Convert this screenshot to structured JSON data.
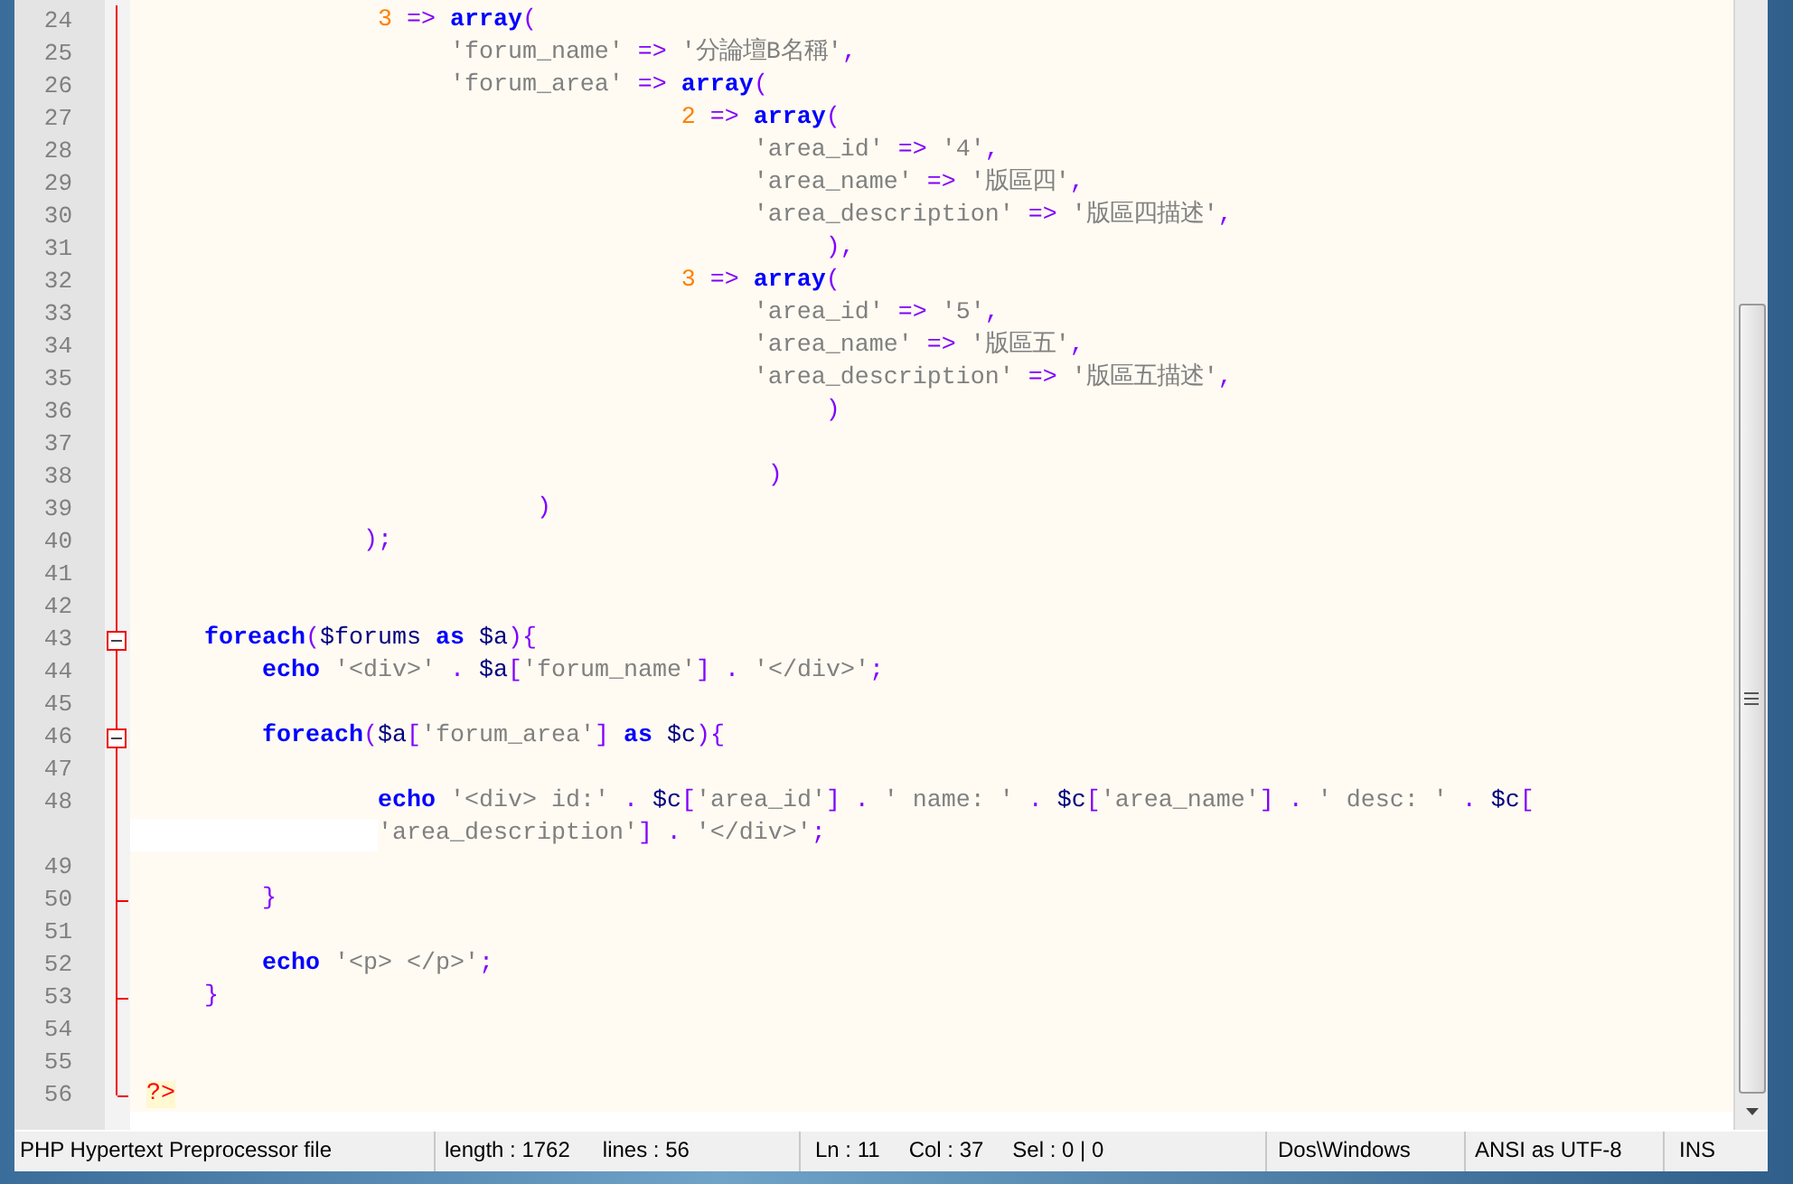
{
  "editor": {
    "lines": [
      {
        "number": "24",
        "fold_start": false,
        "fold_end": false,
        "tokens": [
          {
            "kind": "number",
            "text": "3"
          },
          {
            "kind": "operator",
            "text": " =>"
          },
          {
            "kind": "keyword",
            "text": " array"
          },
          {
            "kind": "operator",
            "text": "("
          }
        ]
      },
      {
        "number": "25",
        "fold_start": false,
        "fold_end": false,
        "tokens": [
          {
            "kind": "string",
            "text": "'forum_name'"
          },
          {
            "kind": "operator",
            "text": " =>"
          },
          {
            "kind": "string",
            "text": " '分論壇B名稱'"
          },
          {
            "kind": "operator",
            "text": ","
          }
        ]
      },
      {
        "number": "26",
        "fold_start": false,
        "fold_end": false,
        "tokens": [
          {
            "kind": "string",
            "text": "'forum_area'"
          },
          {
            "kind": "operator",
            "text": " =>"
          },
          {
            "kind": "keyword",
            "text": " array"
          },
          {
            "kind": "operator",
            "text": "("
          }
        ]
      },
      {
        "number": "27",
        "fold_start": false,
        "fold_end": false,
        "tokens": [
          {
            "kind": "number",
            "text": "2"
          },
          {
            "kind": "operator",
            "text": " =>"
          },
          {
            "kind": "keyword",
            "text": " array"
          },
          {
            "kind": "operator",
            "text": "("
          }
        ]
      },
      {
        "number": "28",
        "fold_start": false,
        "fold_end": false,
        "tokens": [
          {
            "kind": "string",
            "text": "'area_id'"
          },
          {
            "kind": "operator",
            "text": " =>"
          },
          {
            "kind": "string",
            "text": " '4'"
          },
          {
            "kind": "operator",
            "text": ","
          }
        ]
      },
      {
        "number": "29",
        "fold_start": false,
        "fold_end": false,
        "tokens": [
          {
            "kind": "string",
            "text": "'area_name'"
          },
          {
            "kind": "operator",
            "text": " =>"
          },
          {
            "kind": "string",
            "text": " '版區四'"
          },
          {
            "kind": "operator",
            "text": ","
          }
        ]
      },
      {
        "number": "30",
        "fold_start": false,
        "fold_end": false,
        "tokens": [
          {
            "kind": "string",
            "text": "'area_description'"
          },
          {
            "kind": "operator",
            "text": " =>"
          },
          {
            "kind": "string",
            "text": " '版區四描述'"
          },
          {
            "kind": "operator",
            "text": ","
          }
        ]
      },
      {
        "number": "31",
        "fold_start": false,
        "fold_end": false,
        "tokens": [
          {
            "kind": "operator",
            "text": "),"
          }
        ]
      },
      {
        "number": "32",
        "fold_start": false,
        "fold_end": false,
        "tokens": [
          {
            "kind": "number",
            "text": "3"
          },
          {
            "kind": "operator",
            "text": " =>"
          },
          {
            "kind": "keyword",
            "text": " array"
          },
          {
            "kind": "operator",
            "text": "("
          }
        ]
      },
      {
        "number": "33",
        "fold_start": false,
        "fold_end": false,
        "tokens": [
          {
            "kind": "string",
            "text": "'area_id'"
          },
          {
            "kind": "operator",
            "text": " =>"
          },
          {
            "kind": "string",
            "text": " '5'"
          },
          {
            "kind": "operator",
            "text": ","
          }
        ]
      },
      {
        "number": "34",
        "fold_start": false,
        "fold_end": false,
        "tokens": [
          {
            "kind": "string",
            "text": "'area_name'"
          },
          {
            "kind": "operator",
            "text": " =>"
          },
          {
            "kind": "string",
            "text": " '版區五'"
          },
          {
            "kind": "operator",
            "text": ","
          }
        ]
      },
      {
        "number": "35",
        "fold_start": false,
        "fold_end": false,
        "tokens": [
          {
            "kind": "string",
            "text": "'area_description'"
          },
          {
            "kind": "operator",
            "text": " =>"
          },
          {
            "kind": "string",
            "text": " '版區五描述'"
          },
          {
            "kind": "operator",
            "text": ","
          }
        ]
      },
      {
        "number": "36",
        "fold_start": false,
        "fold_end": false,
        "tokens": [
          {
            "kind": "operator",
            "text": ")"
          }
        ]
      },
      {
        "number": "37",
        "fold_start": false,
        "fold_end": false
      },
      {
        "number": "38",
        "fold_start": false,
        "fold_end": false,
        "tokens": [
          {
            "kind": "operator",
            "text": ")"
          }
        ]
      },
      {
        "number": "39",
        "fold_start": false,
        "fold_end": false,
        "tokens": [
          {
            "kind": "operator",
            "text": ")"
          }
        ]
      },
      {
        "number": "40",
        "fold_start": false,
        "fold_end": false,
        "tokens": [
          {
            "kind": "operator",
            "text": ");"
          }
        ]
      },
      {
        "number": "41",
        "fold_start": false,
        "fold_end": false
      },
      {
        "number": "42",
        "fold_start": false,
        "fold_end": false
      },
      {
        "number": "43",
        "fold_start": true,
        "fold_end": false,
        "tokens": [
          {
            "kind": "keyword",
            "text": "foreach"
          },
          {
            "kind": "operator",
            "text": "("
          },
          {
            "kind": "variable",
            "text": "$forums"
          },
          {
            "kind": "keyword",
            "text": " as"
          },
          {
            "kind": "variable",
            "text": " $a"
          },
          {
            "kind": "operator",
            "text": "){"
          }
        ]
      },
      {
        "number": "44",
        "fold_start": false,
        "fold_end": false,
        "tokens": [
          {
            "kind": "keyword",
            "text": "echo"
          },
          {
            "kind": "string",
            "text": " '<div>'"
          },
          {
            "kind": "operator",
            "text": " ."
          },
          {
            "kind": "variable",
            "text": " $a"
          },
          {
            "kind": "operator",
            "text": "["
          },
          {
            "kind": "string",
            "text": "'forum_name'"
          },
          {
            "kind": "operator",
            "text": "] ."
          },
          {
            "kind": "string",
            "text": " '</div>'"
          },
          {
            "kind": "operator",
            "text": ";"
          }
        ]
      },
      {
        "number": "45",
        "fold_start": false,
        "fold_end": false
      },
      {
        "number": "46",
        "fold_start": true,
        "fold_end": false,
        "tokens": [
          {
            "kind": "keyword",
            "text": "foreach"
          },
          {
            "kind": "operator",
            "text": "("
          },
          {
            "kind": "variable",
            "text": "$a"
          },
          {
            "kind": "operator",
            "text": "["
          },
          {
            "kind": "string",
            "text": "'forum_area'"
          },
          {
            "kind": "operator",
            "text": "]"
          },
          {
            "kind": "keyword",
            "text": " as"
          },
          {
            "kind": "variable",
            "text": " $c"
          },
          {
            "kind": "operator",
            "text": "){"
          }
        ]
      },
      {
        "number": "47",
        "fold_start": false,
        "fold_end": false
      },
      {
        "number": "48",
        "fold_start": false,
        "fold_end": false,
        "tokens": [
          {
            "kind": "keyword",
            "text": "echo"
          },
          {
            "kind": "string",
            "text": " '<div> id:'"
          },
          {
            "kind": "operator",
            "text": " ."
          },
          {
            "kind": "variable",
            "text": " $c"
          },
          {
            "kind": "operator",
            "text": "["
          },
          {
            "kind": "string",
            "text": "'area_id'"
          },
          {
            "kind": "operator",
            "text": "] ."
          },
          {
            "kind": "string",
            "text": " ' name: '"
          },
          {
            "kind": "operator",
            "text": " ."
          },
          {
            "kind": "variable",
            "text": " $c"
          },
          {
            "kind": "operator",
            "text": "["
          },
          {
            "kind": "string",
            "text": "'area_name'"
          },
          {
            "kind": "operator",
            "text": "] ."
          },
          {
            "kind": "string",
            "text": " ' desc: '"
          },
          {
            "kind": "operator",
            "text": " ."
          },
          {
            "kind": "variable",
            "text": " $c"
          },
          {
            "kind": "operator",
            "text": "["
          }
        ],
        "wrap": [
          {
            "kind": "string",
            "text": "'area_description'"
          },
          {
            "kind": "operator",
            "text": "] ."
          },
          {
            "kind": "string",
            "text": " '</div>'"
          },
          {
            "kind": "operator",
            "text": ";"
          }
        ]
      },
      {
        "number": "49",
        "fold_start": false,
        "fold_end": false
      },
      {
        "number": "50",
        "fold_start": false,
        "fold_end": true,
        "tokens": [
          {
            "kind": "operator",
            "text": "}"
          }
        ]
      },
      {
        "number": "51",
        "fold_start": false,
        "fold_end": false
      },
      {
        "number": "52",
        "fold_start": false,
        "fold_end": false,
        "tokens": [
          {
            "kind": "keyword",
            "text": "echo"
          },
          {
            "kind": "string",
            "text": " '<p> </p>'"
          },
          {
            "kind": "operator",
            "text": ";"
          }
        ]
      },
      {
        "number": "53",
        "fold_start": false,
        "fold_end": true,
        "tokens": [
          {
            "kind": "operator",
            "text": "}"
          }
        ]
      },
      {
        "number": "54",
        "fold_start": false,
        "fold_end": false
      },
      {
        "number": "55",
        "fold_start": false,
        "fold_end": false
      },
      {
        "number": "56",
        "fold_start": false,
        "fold_end": true,
        "tokens": [
          {
            "kind": "tag",
            "text": "?>"
          }
        ]
      }
    ]
  },
  "status_bar": {
    "panels": [
      {
        "items": [
          "PHP Hypertext Preprocessor file"
        ]
      },
      {
        "items": [
          "length : 1762",
          "lines : 56"
        ]
      },
      {
        "items": [
          "Ln : 11",
          "Col : 37",
          "Sel : 0 | 0"
        ]
      },
      {
        "items": [
          "Dos\\Windows"
        ]
      },
      {
        "items": [
          "ANSI as UTF-8"
        ]
      },
      {
        "items": [
          "INS"
        ]
      }
    ]
  }
}
